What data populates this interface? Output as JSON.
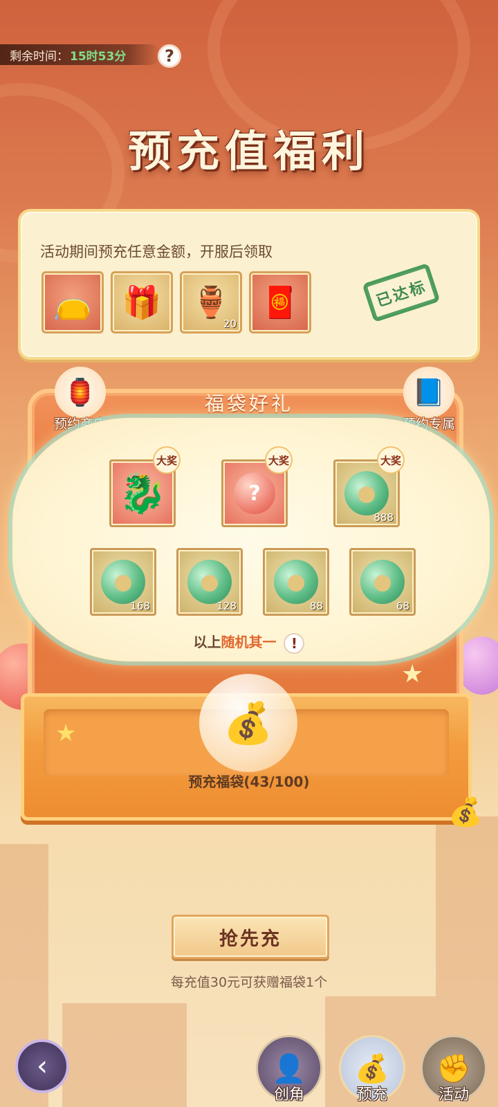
{
  "timer": {
    "label": "剩余时间：",
    "value": "15时53分"
  },
  "title": "预充值福利",
  "notice": {
    "text": "活动期间预充任意金额，开服后领取",
    "items": [
      {
        "icon": "purple-bag-icon",
        "count": ""
      },
      {
        "icon": "gift-box-icon",
        "count": ""
      },
      {
        "icon": "potion-icon",
        "count": "20"
      },
      {
        "icon": "red-envelope-icon",
        "count": ""
      }
    ],
    "stamp": "已达标"
  },
  "board": {
    "title": "福袋好礼",
    "left_button": "预约商店",
    "right_button": "预约专属",
    "grand_badge": "大奖",
    "top_prizes": [
      {
        "icon": "dragon-mount-icon",
        "count": ""
      },
      {
        "icon": "mystery-orb-icon",
        "count": ""
      },
      {
        "icon": "jade-icon",
        "count": "888"
      }
    ],
    "bottom_prizes": [
      {
        "icon": "jade-icon",
        "count": "168"
      },
      {
        "icon": "jade-icon",
        "count": "128"
      },
      {
        "icon": "jade-icon",
        "count": "88"
      },
      {
        "icon": "jade-icon",
        "count": "68"
      }
    ],
    "random_prefix": "以上",
    "random_highlight": "随机其一",
    "bag_label": "预充福袋(43/100)"
  },
  "action": {
    "button": "抢先充",
    "subtext": "每充值30元可获赠福袋1个"
  },
  "nav": [
    {
      "label": "创角",
      "icon": "character-icon"
    },
    {
      "label": "预充",
      "icon": "lucky-bag-icon"
    },
    {
      "label": "活动",
      "icon": "activity-icon"
    }
  ]
}
